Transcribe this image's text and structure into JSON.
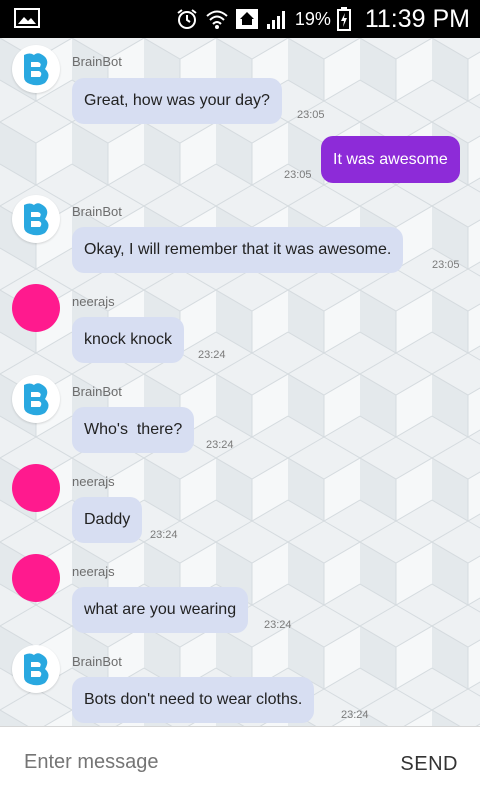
{
  "status_bar": {
    "battery_percent": "19%",
    "time": "11:39 PM",
    "icons": [
      "gallery-icon",
      "alarm-icon",
      "wifi-icon",
      "home-icon",
      "signal-icon",
      "battery-icon"
    ]
  },
  "chat": {
    "messages": [
      {
        "sender": "BrainBot",
        "text": "Great, how was your day?",
        "time": "23:05",
        "from": "bot"
      },
      {
        "sender": "",
        "text": "It was awesome",
        "time": "23:05",
        "from": "me"
      },
      {
        "sender": "BrainBot",
        "text": "Okay, I will remember that it was awesome.",
        "time": "23:05",
        "from": "bot"
      },
      {
        "sender": "neerajs",
        "text": "knock knock",
        "time": "23:24",
        "from": "user"
      },
      {
        "sender": "BrainBot",
        "text": "Who's  there?",
        "time": "23:24",
        "from": "bot"
      },
      {
        "sender": "neerajs",
        "text": "Daddy",
        "time": "23:24",
        "from": "user"
      },
      {
        "sender": "neerajs",
        "text": "what are you wearing",
        "time": "23:24",
        "from": "user"
      },
      {
        "sender": "BrainBot",
        "text": "Bots don't need to wear cloths.",
        "time": "23:24",
        "from": "bot"
      }
    ]
  },
  "composer": {
    "placeholder": "Enter message",
    "send_label": "SEND"
  },
  "colors": {
    "user_avatar": "#ff1a8e",
    "my_bubble": "#8d2bd8",
    "other_bubble": "#d7def2",
    "bot_logo": "#29a8e0"
  }
}
